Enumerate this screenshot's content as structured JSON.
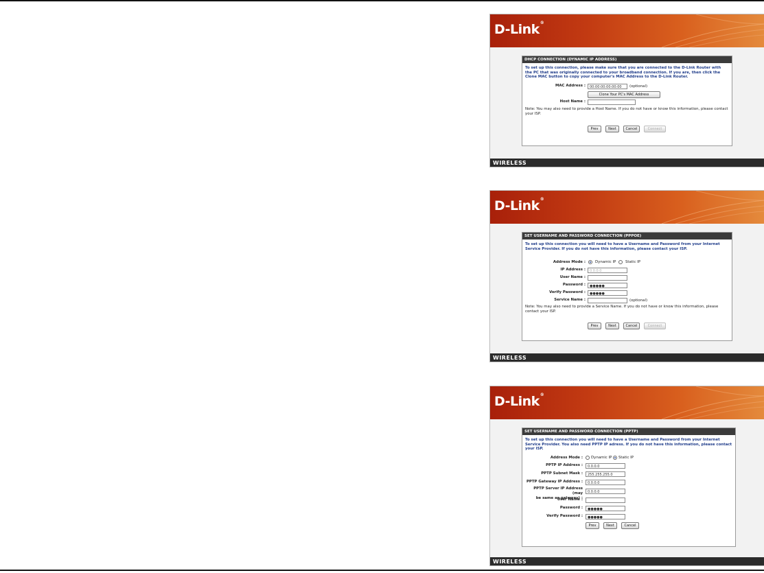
{
  "brand": {
    "logo": "D-Link",
    "footer": "WIRELESS",
    "banner_color": "#c23a12"
  },
  "dhcp": {
    "title": "DHCP CONNECTION (DYNAMIC IP ADDRESS)",
    "intro": "To set up this connection, please make sure that you are connected to the D-Link Router with the PC that was originally connected to your broadband connection. If you are, then click the Clone MAC button to copy your computer's MAC Address to the D-Link Router.",
    "mac_label": "MAC Address :",
    "mac_value": "00:00:00:00:00:00",
    "optional": "(optional)",
    "clone_button": "Clone Your PC's MAC Address",
    "host_label": "Host Name :",
    "host_value": "",
    "note": "Note: You may also need to provide a Host Name. If you do not have or know this information, please contact your ISP.",
    "buttons": {
      "prev": "Prev",
      "next": "Next",
      "cancel": "Cancel",
      "connect": "Connect"
    }
  },
  "pppoe": {
    "title": "SET USERNAME AND PASSWORD CONNECTION (PPPOE)",
    "intro": "To set up this connection you will need to have a Username and Password from your Internet Service Provider. If you do not have this information, please contact your ISP.",
    "address_mode_label": "Address Mode :",
    "dynamic_ip": "Dynamic IP",
    "static_ip": "Static IP",
    "ip_label": "IP Address :",
    "ip_value": "0.0.0.0",
    "user_label": "User Name :",
    "user_value": "",
    "password_label": "Password :",
    "password_value": "●●●●●",
    "verify_label": "Verify Password :",
    "verify_value": "●●●●●",
    "service_label": "Service Name :",
    "service_value": "",
    "optional": "(optional)",
    "note": "Note: You may also need to provide a Service Name. If you do not have or know this information, please contact your ISP.",
    "buttons": {
      "prev": "Prev",
      "next": "Next",
      "cancel": "Cancel",
      "connect": "Connect"
    }
  },
  "pptp": {
    "title": "SET USERNAME AND PASSWORD CONNECTION (PPTP)",
    "intro": "To set up this connection you will need to have a Username and Password from your Internet Service Provider. You also need PPTP IP adress. If you do not have this information, please contact your ISP.",
    "address_mode_label": "Address Mode :",
    "dynamic_ip": "Dynamic IP",
    "static_ip": "Static IP",
    "ip_label": "PPTP IP Address :",
    "ip_value": "0.0.0.0",
    "mask_label": "PPTP Subnet Mask :",
    "mask_value": "255.255.255.0",
    "gateway_label": "PPTP Gateway IP Address :",
    "gateway_value": "0.0.0.0",
    "server_label_1": "PPTP Server IP Address (may",
    "server_label_2": "be same as gateway) :",
    "server_value": "0.0.0.0",
    "user_label": "User Name :",
    "user_value": "",
    "password_label": "Password :",
    "password_value": "●●●●●",
    "verify_label": "Verify Password :",
    "verify_value": "●●●●●",
    "buttons": {
      "prev": "Prev",
      "next": "Next",
      "cancel": "Cancel"
    }
  }
}
